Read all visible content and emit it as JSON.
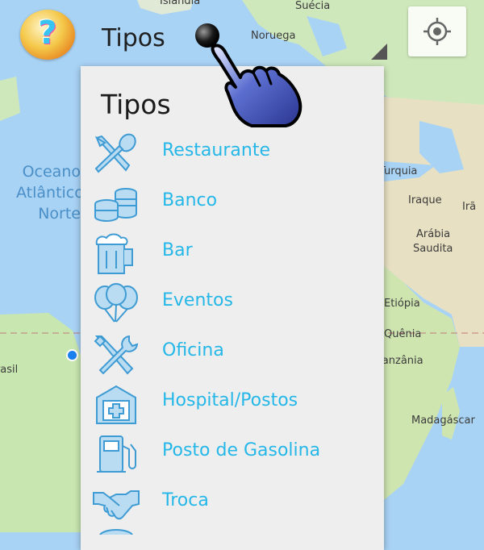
{
  "map": {
    "labels": {
      "islandia": "Islândia",
      "suecia": "Suécia",
      "noruega": "Noruega",
      "ocean_line1": "Oceano",
      "ocean_line2": "Atlântico",
      "ocean_line3": "Norte",
      "turquia": "Turquia",
      "iraque": "Iraque",
      "ira": "Irã",
      "arabia_line1": "Arábia",
      "arabia_line2": "Saudita",
      "etiopia": "Etiópia",
      "quenia": "Quênia",
      "tanzania": "Tanzânia",
      "madagascar": "Madagáscar",
      "brasil": "Brasil"
    }
  },
  "topbar": {
    "spinner_label": "Tipos"
  },
  "dropdown": {
    "title": "Tipos",
    "options": [
      {
        "label": "Restaurante",
        "icon": "cutlery-icon"
      },
      {
        "label": "Banco",
        "icon": "coins-icon"
      },
      {
        "label": "Bar",
        "icon": "beer-mug-icon"
      },
      {
        "label": "Eventos",
        "icon": "balloons-icon"
      },
      {
        "label": "Oficina",
        "icon": "tools-icon"
      },
      {
        "label": "Hospital/Postos",
        "icon": "hospital-icon"
      },
      {
        "label": "Posto de Gasolina",
        "icon": "fuel-pump-icon"
      },
      {
        "label": "Troca",
        "icon": "handshake-icon"
      }
    ]
  },
  "colors": {
    "accent": "#25b7e8",
    "icon_stroke": "#4aa3d6",
    "water": "#a9d3f5",
    "land": "#c8e6b0",
    "dropdown_bg": "#eeeeee"
  }
}
